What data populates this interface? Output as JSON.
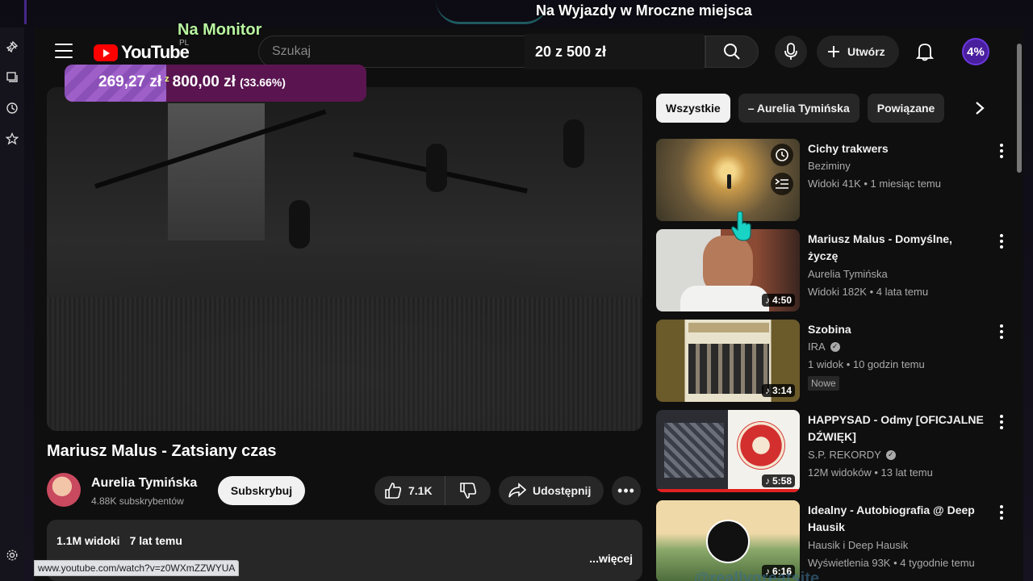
{
  "overlay": {
    "top_title": "Na Wyjazdy w Mroczne miejsca",
    "monitor_label": "Na Monitor",
    "goal_text": "20 z 500 zł",
    "donation": {
      "current": "269,27 zł",
      "sep": "z",
      "target": "800,00 zł",
      "percent": "(33.66%)",
      "progress_fraction": 0.3366
    },
    "bottom_text": "@reallygreatsite"
  },
  "header": {
    "logo_text": "YouTube",
    "region": "PL",
    "search_placeholder": "Szukaj",
    "create_label": "Utwórz",
    "avatar_text": "4%"
  },
  "video": {
    "title": "Mariusz Malus - Zatsiany czas",
    "channel": "Aurelia Tymińska",
    "subscribers": "4.88K subskrybentów",
    "subscribe_label": "Subskrybuj",
    "likes": "7.1K",
    "share_label": "Udostępnij",
    "views": "1.1M widoki",
    "age": "7 lat temu",
    "more_label": "...więcej"
  },
  "chips": [
    "Wszystkie",
    "– Aurelia Tymińska",
    "Powiązane"
  ],
  "recommendations": [
    {
      "title_lines": [
        "Cichy trakwers"
      ],
      "channel": "Beziminy",
      "verified": false,
      "info": "Widoki 41K • 1 miesiąc temu",
      "duration": "",
      "badge": ""
    },
    {
      "title_lines": [
        "Mariusz Malus - Domyślne,",
        "życzę"
      ],
      "channel": "Aurelia Tymińska",
      "verified": false,
      "info": "Widoki 182K • 4 lata temu",
      "duration": "4:50",
      "badge": ""
    },
    {
      "title_lines": [
        "Szobina"
      ],
      "channel": "IRA",
      "verified": true,
      "info": "1 widok • 10 godzin temu",
      "duration": "3:14",
      "badge": "Nowe"
    },
    {
      "title_lines": [
        "HAPPYSAD - Odmy [OFICJALNE",
        "DŹWIĘK]"
      ],
      "channel": "S.P. REKORDY",
      "verified": true,
      "info": "12M widoków • 13 lat temu",
      "duration": "5:58",
      "badge": ""
    },
    {
      "title_lines": [
        "Idealny - Autobiografia @ Deep",
        "Hausik"
      ],
      "channel": "Hausik i Deep Hausik",
      "verified": false,
      "info": "Wyświetlenia 93K • 4 tygodnie temu",
      "duration": "6:16",
      "badge": ""
    }
  ],
  "status_url": "www.youtube.com/watch?v=z0WXmZZWYUA"
}
